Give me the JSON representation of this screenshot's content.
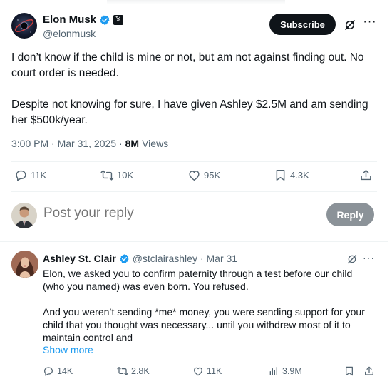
{
  "tweet": {
    "author_name": "Elon Musk",
    "author_handle": "@elonmusk",
    "subscribe_label": "Subscribe",
    "paragraphs": [
      "I don’t know if the child is mine or not, but am not against finding out. No court order is needed.",
      "Despite not knowing for sure, I have given Ashley $2.5M and am sending her $500k/year."
    ],
    "time": "3:00 PM · Mar 31, 2025 ·",
    "views_count": "8M",
    "views_label": "Views",
    "stats": {
      "replies": "11K",
      "reposts": "10K",
      "likes": "95K",
      "bookmarks": "4.3K"
    }
  },
  "reply_box": {
    "placeholder": "Post your reply",
    "button_label": "Reply"
  },
  "reply": {
    "author_name": "Ashley St. Clair",
    "author_handle": "@stclairashley",
    "date": "· Mar 31",
    "paragraphs": [
      "Elon, we asked you to confirm paternity through a test before our child (who you named) was even born. You refused.",
      "And you weren’t sending *me* money, you were sending support for your child that you thought was necessary... until you withdrew most of it to maintain control and"
    ],
    "show_more": "Show more",
    "stats": {
      "replies": "14K",
      "reposts": "2.8K",
      "likes": "11K",
      "views": "3.9M"
    }
  },
  "colors": {
    "text": "#0f1419",
    "secondary": "#536471",
    "verified": "#1d9bf0",
    "link": "#1d9bf0"
  },
  "icons": [
    "verified-badge-icon",
    "x-affiliate-icon",
    "grok-icon",
    "more-icon",
    "reply-icon",
    "repost-icon",
    "like-icon",
    "bookmark-icon",
    "share-icon",
    "views-icon"
  ]
}
